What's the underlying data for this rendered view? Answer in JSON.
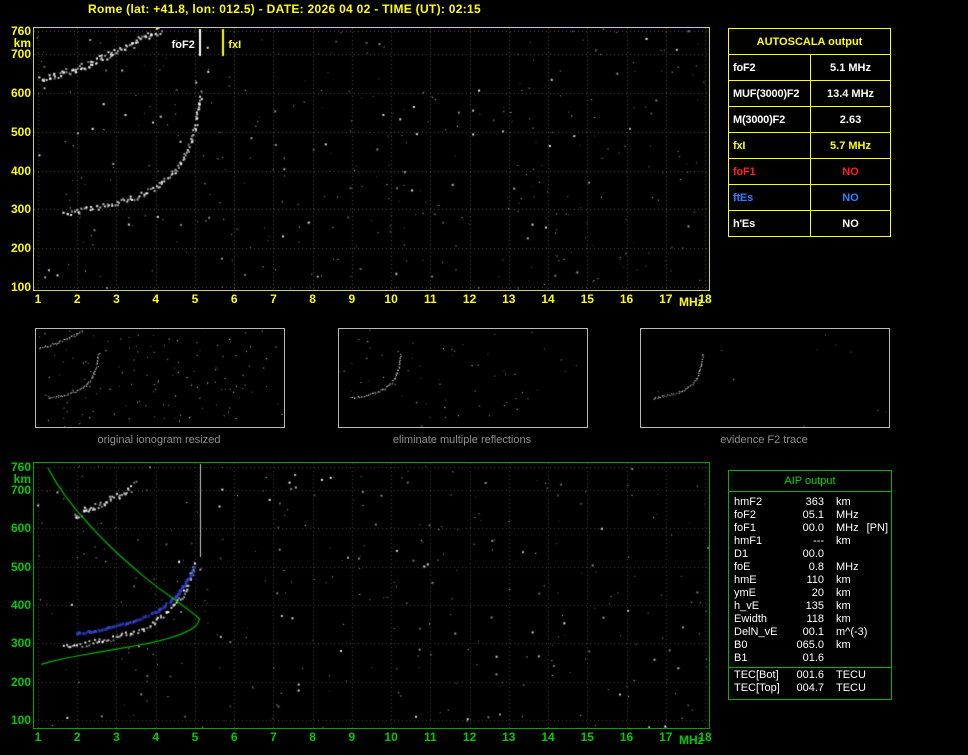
{
  "header": {
    "title": "Rome (lat: +41.8, lon: 012.5) - DATE: 2026 04 02 - TIME (UT): 02:15"
  },
  "colors": {
    "yellow": "#ffff00",
    "plot_border_top": "#cfcf66",
    "plot_border_bottom": "#00a400",
    "green_text": "#00cc00",
    "red": "#ff2020",
    "blue": "#3080ff",
    "restored_trace_blue": "#3346d6",
    "profile_green": "#00bb00",
    "caption_gray": "#8f8f8f",
    "grid_top": "#4f4f35",
    "grid_bottom": "#3f3f3f"
  },
  "autoscala_table": {
    "title": "AUTOSCALA output",
    "rows": [
      {
        "label": "foF2",
        "value": "5.1 MHz",
        "color": "#ffffff"
      },
      {
        "label": "MUF(3000)F2",
        "value": "13.4 MHz",
        "color": "#ffffff"
      },
      {
        "label": "M(3000)F2",
        "value": "2.63",
        "color": "#ffffff"
      },
      {
        "label": "fxI",
        "value": "5.7 MHz",
        "color": "#ffff00"
      },
      {
        "label": "foF1",
        "value": "NO",
        "color": "#ff2020"
      },
      {
        "label": "ftEs",
        "value": "NO",
        "color": "#3080ff"
      },
      {
        "label": "h'Es",
        "value": "NO",
        "color": "#ffffff"
      }
    ]
  },
  "thumbnails": {
    "items": [
      {
        "caption": "original ionogram resized",
        "show": [
          "F2-trace",
          "second-hop"
        ],
        "noise": 140,
        "seed": 21
      },
      {
        "caption": "eliminate multiple reflections",
        "show": [
          "F2-trace"
        ],
        "noise": 60,
        "seed": 22
      },
      {
        "caption": "evidence F2 trace",
        "show": [
          "F2-trace"
        ],
        "noise": 10,
        "seed": 23
      }
    ]
  },
  "aip_table": {
    "title": "AIP output",
    "rows": [
      {
        "label": "hmF2",
        "value": "363",
        "unit": "km"
      },
      {
        "label": "foF2",
        "value": "05.1",
        "unit": "MHz"
      },
      {
        "label": "foF1",
        "value": "00.0",
        "unit": "MHz",
        "extra": "[PN]"
      },
      {
        "label": "hmF1",
        "value": "---",
        "unit": "km"
      },
      {
        "label": "D1",
        "value": "00.0",
        "unit": ""
      },
      {
        "label": "foE",
        "value": "0.8",
        "unit": "MHz"
      },
      {
        "label": "hmE",
        "value": "110",
        "unit": "km"
      },
      {
        "label": "ymE",
        "value": "20",
        "unit": "km"
      },
      {
        "label": "h_vE",
        "value": "135",
        "unit": "km"
      },
      {
        "label": "Ewidth",
        "value": "118",
        "unit": "km"
      },
      {
        "label": "DelN_vE",
        "value": "00.1",
        "unit": "m^(-3)"
      },
      {
        "label": "B0",
        "value": "065.0",
        "unit": "km"
      },
      {
        "label": "B1",
        "value": "01.6",
        "unit": ""
      }
    ],
    "tec_rows": [
      {
        "label": "TEC[Bot]",
        "value": "001.6",
        "unit": "TECU"
      },
      {
        "label": "TEC[Top]",
        "value": "004.7",
        "unit": "TECU"
      }
    ]
  },
  "chart_data": [
    {
      "id": "top_ionogram",
      "type": "scatter",
      "title": "Ionogram with autoscaled characteristics",
      "xlabel": "MHz",
      "ylabel": "km",
      "xlim": [
        1,
        18
      ],
      "ylim": [
        100,
        760
      ],
      "xticks": [
        1,
        2,
        3,
        4,
        5,
        6,
        7,
        8,
        9,
        10,
        11,
        12,
        13,
        14,
        15,
        16,
        17,
        18
      ],
      "yticks": [
        100,
        200,
        300,
        400,
        500,
        600,
        700,
        760
      ],
      "grid": true,
      "noise_dots": 380,
      "markers": [
        {
          "label": "foF2",
          "freq": 5.1,
          "color": "#ffffff",
          "len": 27,
          "width": 2,
          "side": "left"
        },
        {
          "label": "fxI",
          "freq": 5.7,
          "color": "#ffff00",
          "len": 27,
          "width": 2,
          "side": "right"
        }
      ],
      "series": [
        {
          "name": "F2-trace",
          "color": "#ffffff",
          "style": "scatter",
          "dot": 2,
          "jx": 3,
          "jy": 5,
          "density": 0.55,
          "points": [
            [
              1.65,
              292
            ],
            [
              1.9,
              296
            ],
            [
              2.15,
              300
            ],
            [
              2.4,
              305
            ],
            [
              2.65,
              310
            ],
            [
              2.9,
              316
            ],
            [
              3.15,
              323
            ],
            [
              3.4,
              331
            ],
            [
              3.65,
              341
            ],
            [
              3.9,
              353
            ],
            [
              4.1,
              366
            ],
            [
              4.3,
              382
            ],
            [
              4.5,
              402
            ],
            [
              4.65,
              424
            ],
            [
              4.78,
              448
            ],
            [
              4.88,
              474
            ],
            [
              4.96,
              502
            ],
            [
              5.02,
              530
            ],
            [
              5.07,
              557
            ],
            [
              5.11,
              583
            ],
            [
              5.14,
              605
            ]
          ]
        },
        {
          "name": "second-hop",
          "color": "#ffffff",
          "style": "scatter",
          "dot": 2,
          "jx": 4,
          "jy": 7,
          "density": 0.8,
          "points": [
            [
              1.05,
              638
            ],
            [
              1.35,
              646
            ],
            [
              1.65,
              655
            ],
            [
              1.95,
              665
            ],
            [
              2.25,
              676
            ],
            [
              2.55,
              688
            ],
            [
              2.85,
              701
            ],
            [
              3.15,
              715
            ],
            [
              3.45,
              730
            ],
            [
              3.7,
              744
            ],
            [
              3.95,
              756
            ],
            [
              4.15,
              765
            ]
          ]
        }
      ]
    },
    {
      "id": "bottom_ionogram",
      "type": "scatter",
      "title": "Ionogram with restored trace and electron density profile",
      "xlabel": "MHz",
      "ylabel": "km",
      "xlim": [
        1,
        18
      ],
      "ylim": [
        100,
        760
      ],
      "xticks": [
        1,
        2,
        3,
        4,
        5,
        6,
        7,
        8,
        9,
        10,
        11,
        12,
        13,
        14,
        15,
        16,
        17,
        18
      ],
      "yticks": [
        100,
        200,
        300,
        400,
        500,
        600,
        700,
        760
      ],
      "grid": true,
      "noise_dots": 320,
      "markers": [
        {
          "label": "",
          "freq": 5.12,
          "color": "#c8c8c8",
          "len": 93,
          "width": 1,
          "side": "right"
        }
      ],
      "series": [
        {
          "name": "F2-trace",
          "color": "#ffffff",
          "style": "scatter",
          "dot": 2,
          "jx": 3,
          "jy": 5,
          "density": 0.5,
          "points": [
            [
              1.65,
              292
            ],
            [
              1.9,
              296
            ],
            [
              2.15,
              300
            ],
            [
              2.4,
              305
            ],
            [
              2.65,
              310
            ],
            [
              2.9,
              316
            ],
            [
              3.15,
              323
            ],
            [
              3.4,
              331
            ],
            [
              3.65,
              341
            ],
            [
              3.9,
              353
            ],
            [
              4.1,
              366
            ],
            [
              4.3,
              382
            ],
            [
              4.5,
              402
            ],
            [
              4.65,
              424
            ],
            [
              4.78,
              448
            ],
            [
              4.88,
              474
            ],
            [
              4.96,
              502
            ],
            [
              5.02,
              518
            ]
          ]
        },
        {
          "name": "second-hop",
          "color": "#ffffff",
          "style": "scatter",
          "dot": 2,
          "jx": 4,
          "jy": 6,
          "density": 0.6,
          "points": [
            [
              1.9,
              632
            ],
            [
              2.15,
              644
            ],
            [
              2.4,
              656
            ],
            [
              2.65,
              668
            ],
            [
              2.9,
              681
            ],
            [
              3.15,
              694
            ],
            [
              3.4,
              707
            ]
          ]
        },
        {
          "name": "restored-trace",
          "color": "#3346d6",
          "style": "scatter",
          "dot": 3,
          "jx": 2,
          "jy": 2,
          "density": 0.5,
          "points": [
            [
              1.95,
              328
            ],
            [
              2.2,
              332
            ],
            [
              2.45,
              336
            ],
            [
              2.7,
              341
            ],
            [
              2.95,
              347
            ],
            [
              3.2,
              354
            ],
            [
              3.45,
              362
            ],
            [
              3.7,
              372
            ],
            [
              3.95,
              384
            ],
            [
              4.15,
              397
            ],
            [
              4.35,
              413
            ],
            [
              4.52,
              431
            ],
            [
              4.67,
              450
            ],
            [
              4.8,
              470
            ],
            [
              4.9,
              489
            ],
            [
              4.98,
              505
            ]
          ]
        },
        {
          "name": "density-profile",
          "color": "#00bb00",
          "style": "line",
          "points": [
            [
              1.25,
              758
            ],
            [
              1.45,
              722
            ],
            [
              1.7,
              684
            ],
            [
              2.0,
              645
            ],
            [
              2.3,
              610
            ],
            [
              2.65,
              572
            ],
            [
              3.0,
              537
            ],
            [
              3.35,
              505
            ],
            [
              3.7,
              474
            ],
            [
              4.05,
              446
            ],
            [
              4.4,
              420
            ],
            [
              4.7,
              398
            ],
            [
              4.9,
              382
            ],
            [
              5.05,
              370
            ],
            [
              5.12,
              363
            ],
            [
              5.05,
              348
            ],
            [
              4.9,
              336
            ],
            [
              4.65,
              324
            ],
            [
              4.3,
              312
            ],
            [
              3.9,
              302
            ],
            [
              3.45,
              293
            ],
            [
              3.0,
              285
            ],
            [
              2.55,
              277
            ],
            [
              2.1,
              269
            ],
            [
              1.7,
              261
            ],
            [
              1.35,
              253
            ],
            [
              1.08,
              245
            ]
          ]
        }
      ]
    }
  ]
}
